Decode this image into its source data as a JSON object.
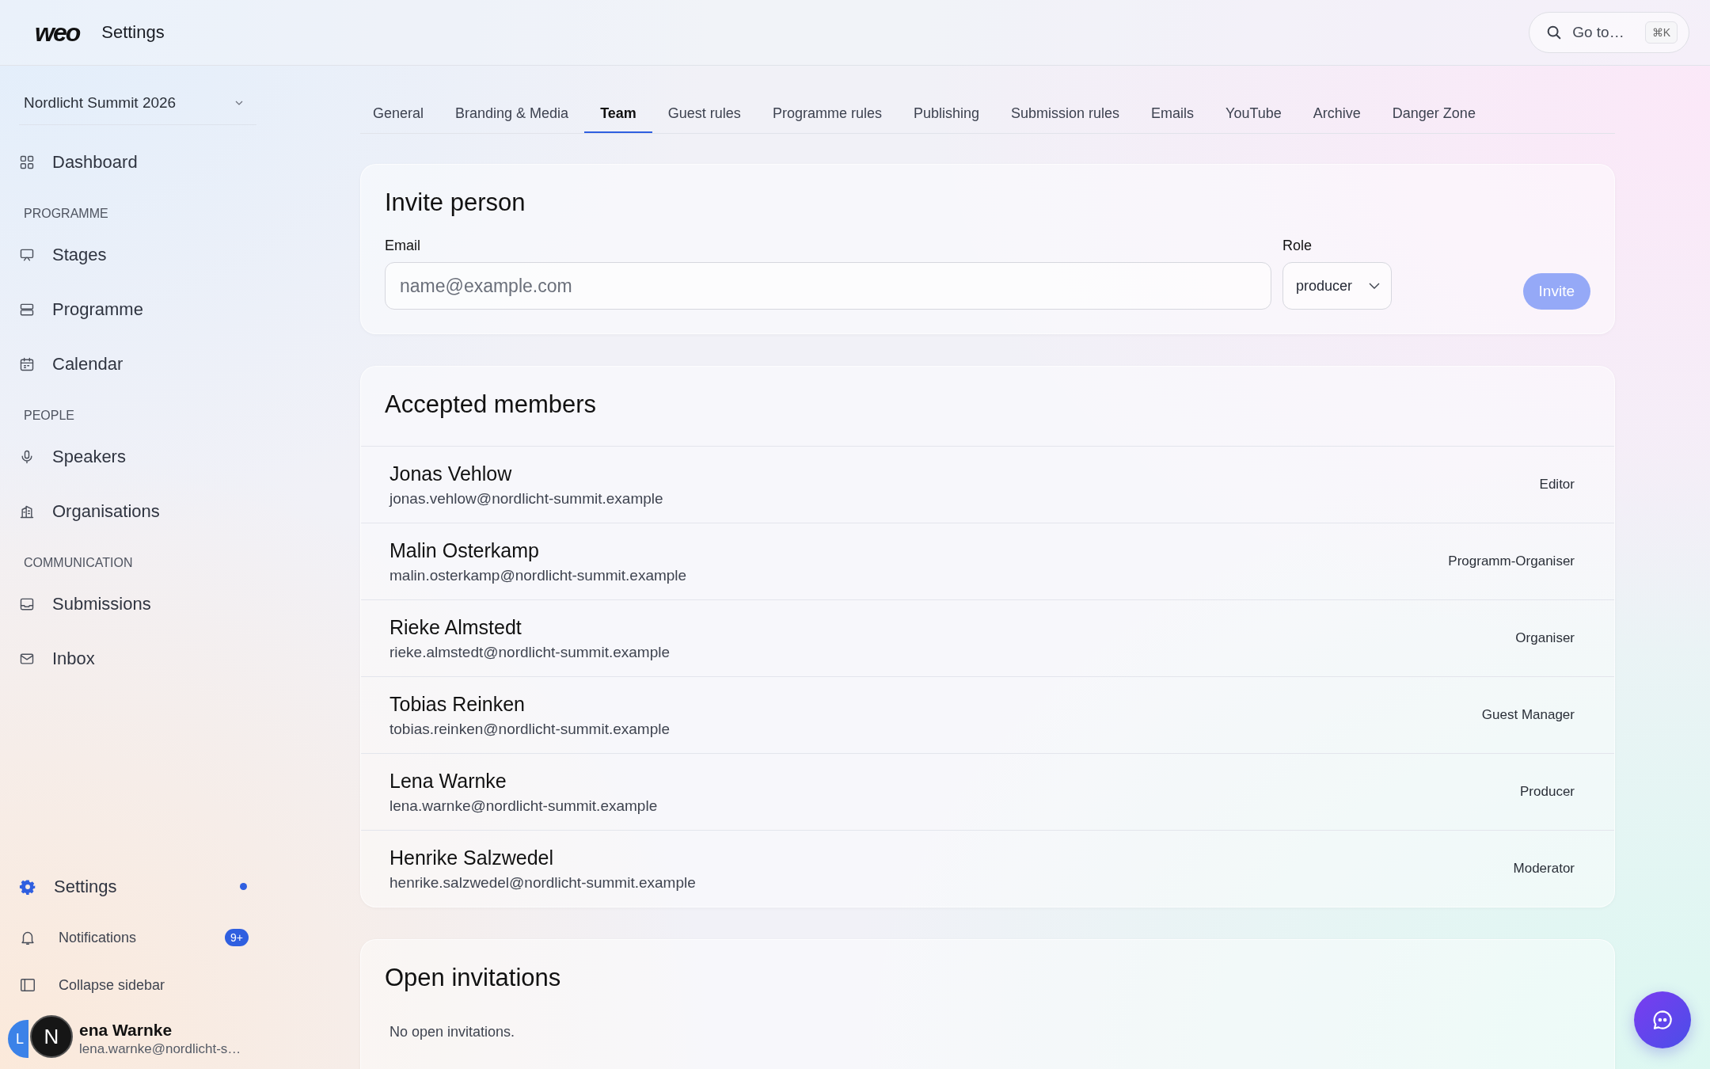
{
  "header": {
    "logo": "weo",
    "title": "Settings",
    "search": {
      "placeholder": "Go to…",
      "shortcut": "⌘K"
    }
  },
  "sidebar": {
    "workspace": "Nordlicht Summit 2026",
    "groups": [
      {
        "items": [
          {
            "label": "Dashboard",
            "selected": false
          }
        ]
      },
      {
        "heading": "PROGRAMME",
        "items": [
          {
            "label": "Stages",
            "selected": false
          },
          {
            "label": "Programme",
            "selected": false
          },
          {
            "label": "Calendar",
            "selected": false
          }
        ]
      },
      {
        "heading": "PEOPLE",
        "items": [
          {
            "label": "Speakers",
            "selected": false
          },
          {
            "label": "Organisations",
            "selected": false
          }
        ]
      },
      {
        "heading": "COMMUNICATION",
        "items": [
          {
            "label": "Submissions",
            "selected": false
          },
          {
            "label": "Inbox",
            "selected": false
          }
        ]
      }
    ],
    "settings": {
      "label": "Settings",
      "selected": true,
      "has_update": true
    },
    "notifications": {
      "label": "Notifications",
      "badge": "9+"
    },
    "collapse": {
      "label": "Collapse sidebar"
    },
    "user": {
      "initials": "L",
      "name": "ena Warnke",
      "email": "lena.warnke@nordlicht-s…"
    },
    "dev_badge": "N"
  },
  "tabs": [
    {
      "label": "General",
      "selected": false
    },
    {
      "label": "Branding & Media",
      "selected": false
    },
    {
      "label": "Team",
      "selected": true
    },
    {
      "label": "Guest rules",
      "selected": false
    },
    {
      "label": "Programme rules",
      "selected": false
    },
    {
      "label": "Publishing",
      "selected": false
    },
    {
      "label": "Submission rules",
      "selected": false
    },
    {
      "label": "Emails",
      "selected": false
    },
    {
      "label": "YouTube",
      "selected": false
    },
    {
      "label": "Archive",
      "selected": false
    },
    {
      "label": "Danger Zone",
      "selected": false
    }
  ],
  "invite": {
    "title": "Invite person",
    "email_label": "Email",
    "email_placeholder": "name@example.com",
    "role_label": "Role",
    "role_value": "producer",
    "button": {
      "label": "Invite",
      "disabled": true
    }
  },
  "members": {
    "title": "Accepted members",
    "rows": [
      {
        "name": "Jonas Vehlow",
        "email": "jonas.vehlow@nordlicht-summit.example",
        "role": "Editor"
      },
      {
        "name": "Malin Osterkamp",
        "email": "malin.osterkamp@nordlicht-summit.example",
        "role": "Programm-Organiser"
      },
      {
        "name": "Rieke Almstedt",
        "email": "rieke.almstedt@nordlicht-summit.example",
        "role": "Organiser"
      },
      {
        "name": "Tobias Reinken",
        "email": "tobias.reinken@nordlicht-summit.example",
        "role": "Guest Manager"
      },
      {
        "name": "Lena Warnke",
        "email": "lena.warnke@nordlicht-summit.example",
        "role": "Producer"
      },
      {
        "name": "Henrike Salzwedel",
        "email": "henrike.salzwedel@nordlicht-summit.example",
        "role": "Moderator"
      }
    ]
  },
  "invitations": {
    "title": "Open invitations",
    "empty": "No open invitations."
  }
}
